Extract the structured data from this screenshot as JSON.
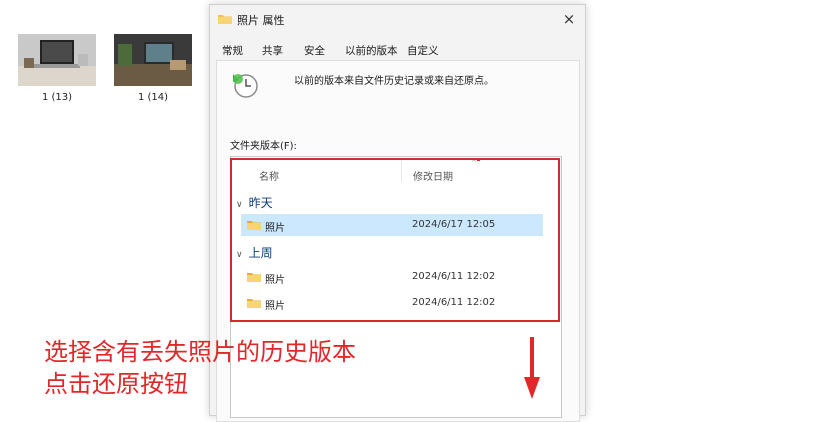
{
  "background": {
    "files": [
      {
        "label": "1 (13)"
      },
      {
        "label": "1 (14)"
      }
    ]
  },
  "dialog": {
    "title": "照片 属性",
    "close": "×",
    "tabs": [
      "常规",
      "共享",
      "安全",
      "以前的版本",
      "自定义"
    ],
    "active_tab": "以前的版本",
    "description": "以前的版本来自文件历史记录或来自还原点。",
    "list_label": "文件夹版本(F):",
    "columns": {
      "name": "名称",
      "date": "修改日期"
    },
    "groups": [
      {
        "label": "昨天",
        "rows": [
          {
            "name": "照片",
            "date": "2024/6/17 12:05",
            "selected": true
          }
        ]
      },
      {
        "label": "上周",
        "rows": [
          {
            "name": "照片",
            "date": "2024/6/11 12:02",
            "selected": false
          },
          {
            "name": "照片",
            "date": "2024/6/11 12:02",
            "selected": false
          }
        ]
      }
    ]
  },
  "annotation": {
    "line1": "选择含有丢失照片的历史版本",
    "line2": "点击还原按钮",
    "color": "#e0282a"
  },
  "colors": {
    "highlight_box": "#d42a2a",
    "selection": "#cce8ff",
    "folder": "#f2c14e"
  }
}
